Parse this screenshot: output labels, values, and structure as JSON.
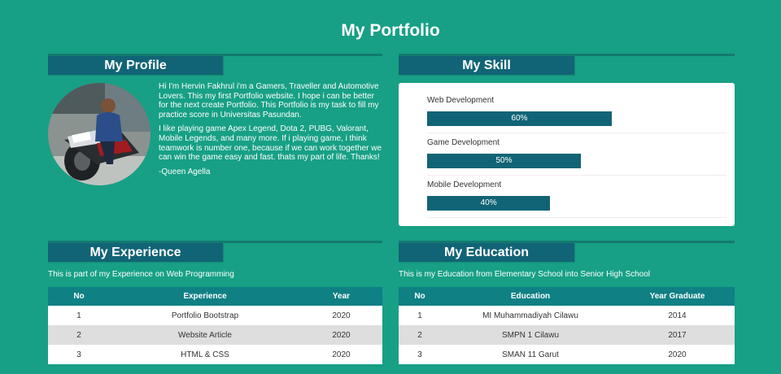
{
  "page_title": "My Portfolio",
  "profile": {
    "heading": "My Profile",
    "paragraphs": [
      "Hi I'm Hervin Fakhrul i'm a Gamers, Traveller and Automotive Lovers. This my first Portfolio website. I hope i can be better for the next create Portfolio. This Portfolio is my task to fill my practice score in Universitas Pasundan.",
      "I like playing game Apex Legend, Dota 2, PUBG, Valorant, Mobile Legends, and many more. If i playing game, i think teamwork is number one, because if we can work together we can win the game easy and fast. thats my part of life. Thanks!",
      "-Queen Agella"
    ]
  },
  "skills": {
    "heading": "My Skill",
    "items": [
      {
        "label": "Web Development",
        "percent": 60,
        "text": "60%"
      },
      {
        "label": "Game Development",
        "percent": 50,
        "text": "50%"
      },
      {
        "label": "Mobile Development",
        "percent": 40,
        "text": "40%"
      }
    ]
  },
  "experience": {
    "heading": "My Experience",
    "description": "This is part of my Experience on Web Programming",
    "columns": [
      "No",
      "Experience",
      "Year"
    ],
    "rows": [
      [
        "1",
        "Portfolio Bootstrap",
        "2020"
      ],
      [
        "2",
        "Website Article",
        "2020"
      ],
      [
        "3",
        "HTML & CSS",
        "2020"
      ]
    ]
  },
  "education": {
    "heading": "My Education",
    "description": "This is my Education from Elementary School into Senior High School",
    "columns": [
      "No",
      "Education",
      "Year Graduate"
    ],
    "rows": [
      [
        "1",
        "MI Muhammadiyah Cilawu",
        "2014"
      ],
      [
        "2",
        "SMPN 1 Cilawu",
        "2017"
      ],
      [
        "3",
        "SMAN 11 Garut",
        "2020"
      ]
    ]
  },
  "colors": {
    "background": "#17a085",
    "heading_tab": "#116476",
    "table_header": "#0f8084",
    "skill_bar": "#116476"
  }
}
